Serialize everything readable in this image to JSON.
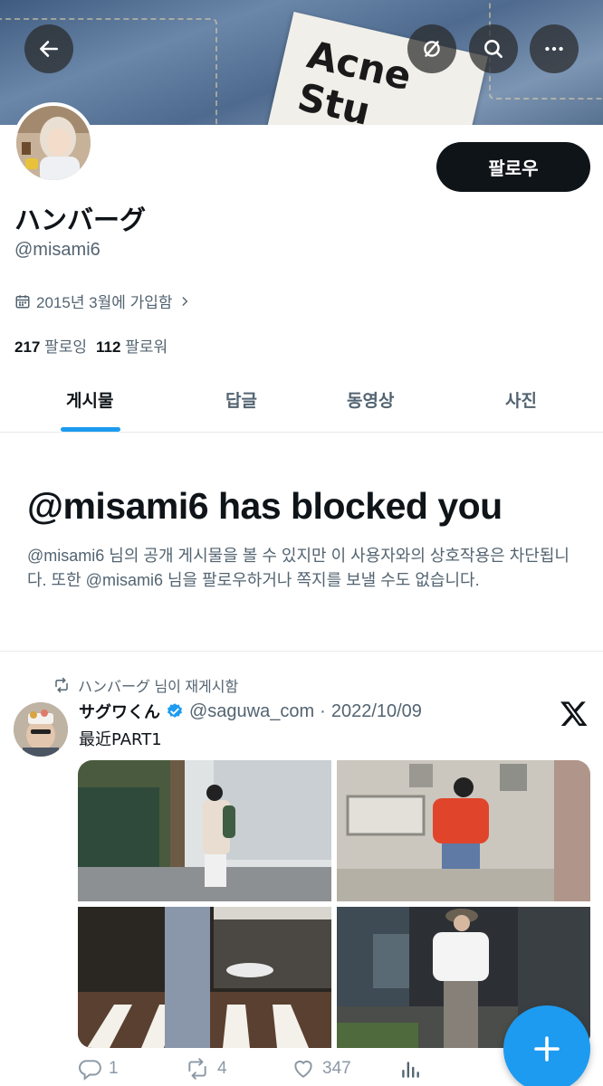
{
  "banner": {
    "label_text": "Acne\nStu",
    "back_icon": "arrow-left-icon",
    "notifications_icon": "bell-off-icon",
    "search_icon": "search-icon",
    "more_icon": "more-horizontal-icon"
  },
  "profile": {
    "follow_label": "팔로우",
    "display_name": "ハンバーグ",
    "handle": "@misami6",
    "joined": "2015년 3월에 가입함",
    "following_count": "217",
    "following_label": "팔로잉",
    "followers_count": "112",
    "followers_label": "팔로워"
  },
  "tabs": [
    {
      "label": "게시물",
      "active": true
    },
    {
      "label": "답글",
      "active": false
    },
    {
      "label": "동영상",
      "active": false
    },
    {
      "label": "사진",
      "active": false
    }
  ],
  "blocked": {
    "title": "@misami6 has blocked you",
    "text": "@misami6 님의 공개 게시물을 볼 수 있지만 이 사용자와의 상호작용은 차단됩니다. 또한 @misami6 님을 팔로우하거나 쪽지를 보낼 수도 없습니다."
  },
  "tweet": {
    "retweet_text": "ハンバーグ 님이 재게시함",
    "author_name": "サグワくん",
    "author_handle": "@saguwa_com",
    "separator": "·",
    "date": "2022/10/09",
    "text": "最近PART1",
    "replies": "1",
    "retweets": "4",
    "likes": "347"
  },
  "colors": {
    "accent": "#1d9bf0",
    "text_primary": "#0f1419",
    "text_secondary": "#536471",
    "follow_button": "#0f1419"
  }
}
